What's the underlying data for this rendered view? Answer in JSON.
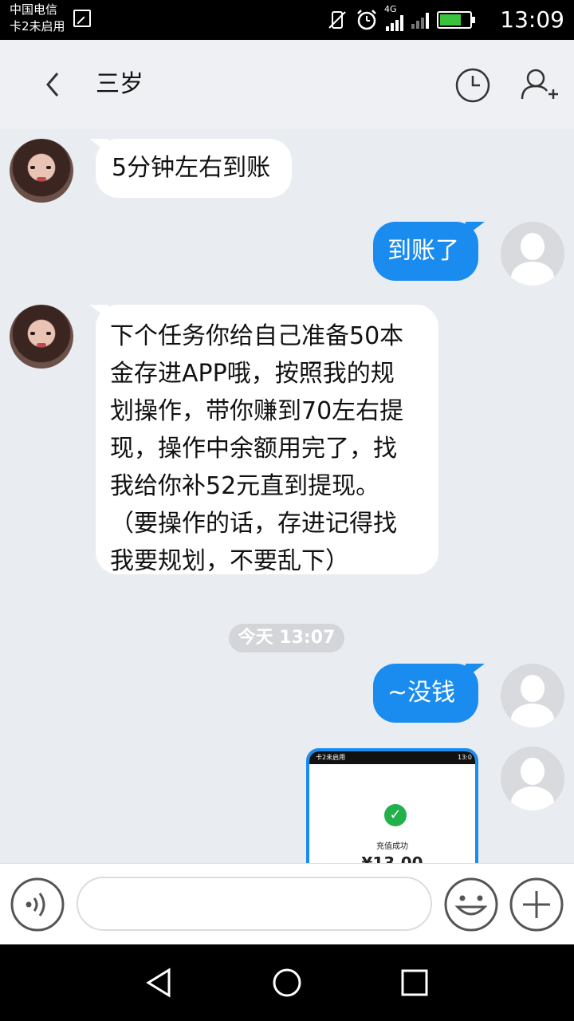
{
  "status_bar": {
    "carrier_line1": "中国电信",
    "carrier_line2": "卡2未启用",
    "network": "4G",
    "time": "13:09"
  },
  "header": {
    "title": "三岁"
  },
  "messages": [
    {
      "side": "left",
      "text": "5分钟左右到账"
    },
    {
      "side": "right",
      "text": "到账了"
    },
    {
      "side": "left",
      "lines": [
        "下个任务你给自己准备50本",
        "金存进APP哦，按照我的规",
        "划操作，带你赚到70左右提",
        "现，操作中余额用完了，找",
        "我给你补52元直到提现。",
        "（要操作的话，存进记得找",
        "我要规划，不要乱下）"
      ]
    },
    {
      "side": "right",
      "text": "~没钱"
    }
  ],
  "time_divider": "今天 13:07",
  "screenshot_message": {
    "status_text": "卡2未启用",
    "status_time": "13:0",
    "success_label": "充值成功",
    "amount": "¥13.00"
  },
  "input": {
    "placeholder": ""
  },
  "colors": {
    "bubble_right": "#1a8cf0",
    "chat_bg": "#e9ecf1"
  }
}
